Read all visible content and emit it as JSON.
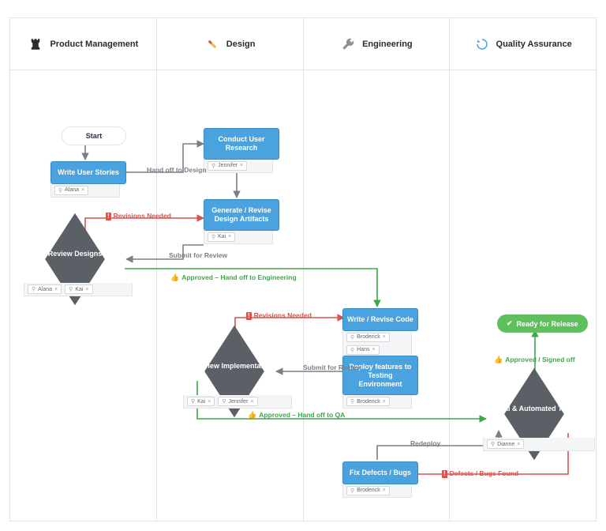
{
  "lanes": {
    "pm": {
      "title": "Product Management"
    },
    "design": {
      "title": "Design"
    },
    "eng": {
      "title": "Engineering"
    },
    "qa": {
      "title": "Quality Assurance"
    }
  },
  "nodes": {
    "start": {
      "label": "Start"
    },
    "write_stories": {
      "label": "Write User Stories",
      "assignees": [
        "Alana"
      ]
    },
    "conduct_research": {
      "label": "Conduct User Research",
      "assignees": [
        "Jennifer"
      ]
    },
    "gen_artifacts": {
      "label": "Generate / Revise Design Artifacts",
      "assignees": [
        "Kai"
      ]
    },
    "review_designs": {
      "label": "Review Designs",
      "assignees": [
        "Alana",
        "Kai"
      ]
    },
    "write_code": {
      "label": "Write / Revise Code",
      "assignees": [
        "Broderick",
        "Hans"
      ]
    },
    "deploy_testing": {
      "label": "Deploy features to Testing Environment",
      "assignees": [
        "Broderick"
      ]
    },
    "review_impl": {
      "label": "Review Implementation",
      "assignees": [
        "Kai",
        "Jennifer"
      ]
    },
    "manual_testing": {
      "label": "Manual & Automated Testing",
      "assignees": [
        "Dianne"
      ]
    },
    "fix_defects": {
      "label": "Fix Defects / Bugs",
      "assignees": [
        "Broderick"
      ]
    },
    "ready_release": {
      "label": "Ready for Release"
    }
  },
  "edges": {
    "handoff_design": "Hand off to Design",
    "submit_review": "Submit for Review",
    "revisions_needed": "Revisions Needed",
    "approved_eng": "Approved – Hand off to Engineering",
    "submit_review2": "Submit for Review",
    "revisions_needed2": "Revisions Needed",
    "approved_qa": "Approved – Hand off to QA",
    "defects_found": "Defects / Bugs Found",
    "redeploy": "Redeploy",
    "approved_signed": "Approved / Signed off"
  },
  "colors": {
    "task": "#4aa3df",
    "decision": "#5a6066",
    "approve": "#3fa64a",
    "reject": "#d9534f",
    "neutral": "#7a7f85"
  }
}
